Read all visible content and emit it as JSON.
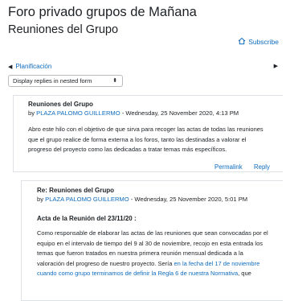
{
  "forum_title": "Foro privado grupos de Mañana",
  "discussion_title": "Reuniones del Grupo",
  "subscribe_label": "Subscribe",
  "nav": {
    "prev_label": "Planificación",
    "prev_arrow": "◀",
    "next_arrow": "▶"
  },
  "display_mode": {
    "selected": "Display replies in nested form"
  },
  "posts": [
    {
      "subject": "Reuniones del Grupo",
      "by_prefix": "by ",
      "author": "PLAZA PALOMO GUILLERMO",
      "date_suffix": " - Wednesday, 25 November 2020, 4:13 PM",
      "lines": [
        "Abro este hilo con el objetivo de que sirva para recoger las actas de todas las reuniones",
        "que el grupo realice de forma externa a los foros, tanto las destinadas a valorar el",
        "progreso del proyecto como las dedicadas a tratar temas más específicos."
      ],
      "actions": {
        "permalink": "Permalink",
        "reply": "Reply"
      }
    },
    {
      "subject": "Re: Reuniones del Grupo",
      "by_prefix": "by ",
      "author": "PLAZA PALOMO GUILLERMO",
      "date_suffix": " - Wednesday, 25 November 2020, 5:01 PM",
      "heading": "Acta de la Reunión del 23/11/20 :",
      "lines": [
        "Como responsable de elaborar las actas de las reuniones que sean convocadas por el",
        "equipo en el intervalo de tiempo del 9 al 30 de noviembre, recojo en esta entrada los",
        "temas que fueron tratados en nuestra primera reunión mensual dedicada a la",
        "valoración del progreso de nuestro proyecto. Sería "
      ],
      "link1": "en la fecha del 17 de noviembre",
      "link2": "cuando como grupo terminamos de definir la Regla 6 de nuestra Normativa",
      "tail": ", que"
    }
  ]
}
